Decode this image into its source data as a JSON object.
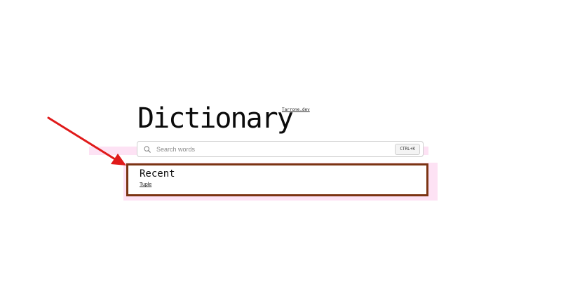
{
  "header": {
    "title": "Dictionary",
    "site_link": "Tarrone.dev"
  },
  "search": {
    "placeholder": "Search words",
    "value": "",
    "shortcut": "CTRL+K",
    "icon": "search-icon"
  },
  "recent": {
    "title": "Recent",
    "items": [
      "Tuple"
    ]
  },
  "colors": {
    "highlight": "#fde2f4",
    "box_border": "#7b3413",
    "arrow": "#e01a1a"
  }
}
